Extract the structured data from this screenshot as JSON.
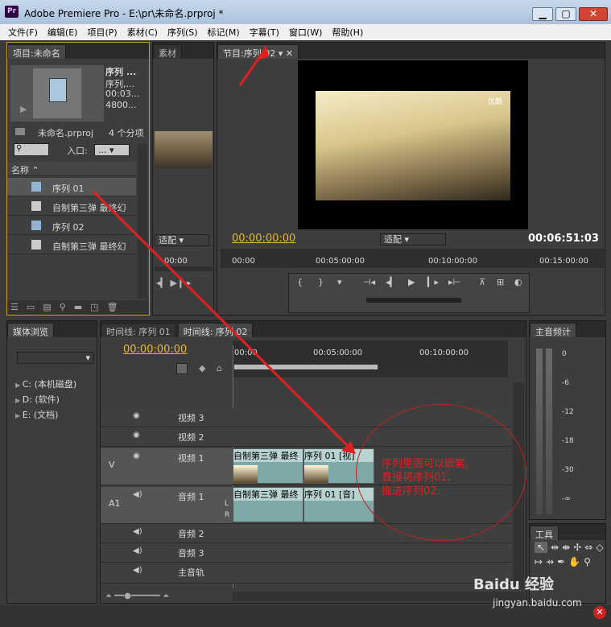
{
  "window": {
    "icon": "Pr",
    "title": "Adobe Premiere Pro - E:\\pr\\未命名.prproj *"
  },
  "menu": [
    "文件(F)",
    "编辑(E)",
    "项目(P)",
    "素材(C)",
    "序列(S)",
    "标记(M)",
    "字幕(T)",
    "窗口(W)",
    "帮助(H)"
  ],
  "project": {
    "tab": "项目:未命名",
    "thumb_title": "序列 ...",
    "thumb_lines": [
      "序列,...",
      "00:03...",
      "4800..."
    ],
    "file": "未命名.prproj",
    "count": "4 个分项",
    "in_label": "入口:",
    "in_value": "...",
    "col_name": "名称",
    "items": [
      {
        "label": "序列 01",
        "type": "sequence"
      },
      {
        "label": "自制第三弹 最终幻",
        "type": "audio"
      },
      {
        "label": "序列 02",
        "type": "sequence"
      },
      {
        "label": "自制第三弹 最终幻",
        "type": "audio"
      }
    ]
  },
  "source": {
    "tab": "素材",
    "fit": "适配",
    "tc": "00:00"
  },
  "program": {
    "tab": "节目:序列 02",
    "watermark": "优酷",
    "tc_left": "00:00:00:00",
    "fit": "适配",
    "tc_right": "00:06:51:03",
    "ruler": [
      "00:00",
      "00:05:00:00",
      "00:10:00:00",
      "00:15:00:00"
    ]
  },
  "media": {
    "tab": "媒体浏览",
    "drives": [
      "C: (本机磁盘)",
      "D: (软件)",
      "E: (文档)"
    ]
  },
  "timeline": {
    "tabs": [
      "时间线: 序列 01",
      "时间线: 序列 02"
    ],
    "tc": "00:00:00:00",
    "ruler": [
      "00:00",
      "00:05:00:00",
      "00:10:00:00"
    ],
    "tracks": [
      {
        "name": "视频 3",
        "tag": ""
      },
      {
        "name": "视频 2",
        "tag": ""
      },
      {
        "name": "视频 1",
        "tag": "V"
      },
      {
        "name": "音频 1",
        "tag": "A1"
      },
      {
        "name": "音频 2",
        "tag": ""
      },
      {
        "name": "音频 3",
        "tag": ""
      },
      {
        "name": "主音轨",
        "tag": ""
      }
    ],
    "clips": {
      "v1a": "自制第三弹 最终",
      "v1b": "序列 01 [视]",
      "a1a": "自制第三弹 最终",
      "a1b": "序列 01 [音]",
      "L": "L",
      "R": "R"
    }
  },
  "annotation": [
    "序列里面可以嵌套,",
    "直接将序列01,",
    "拖进序列02."
  ],
  "audio_meter": {
    "tab": "主音频计",
    "scale": [
      "0",
      "-6",
      "-12",
      "-18",
      "-30",
      "-∞"
    ]
  },
  "tools": {
    "tab": "工具"
  },
  "footer": {
    "watermark": "Baidu 经验",
    "url": "jingyan.baidu.com"
  }
}
